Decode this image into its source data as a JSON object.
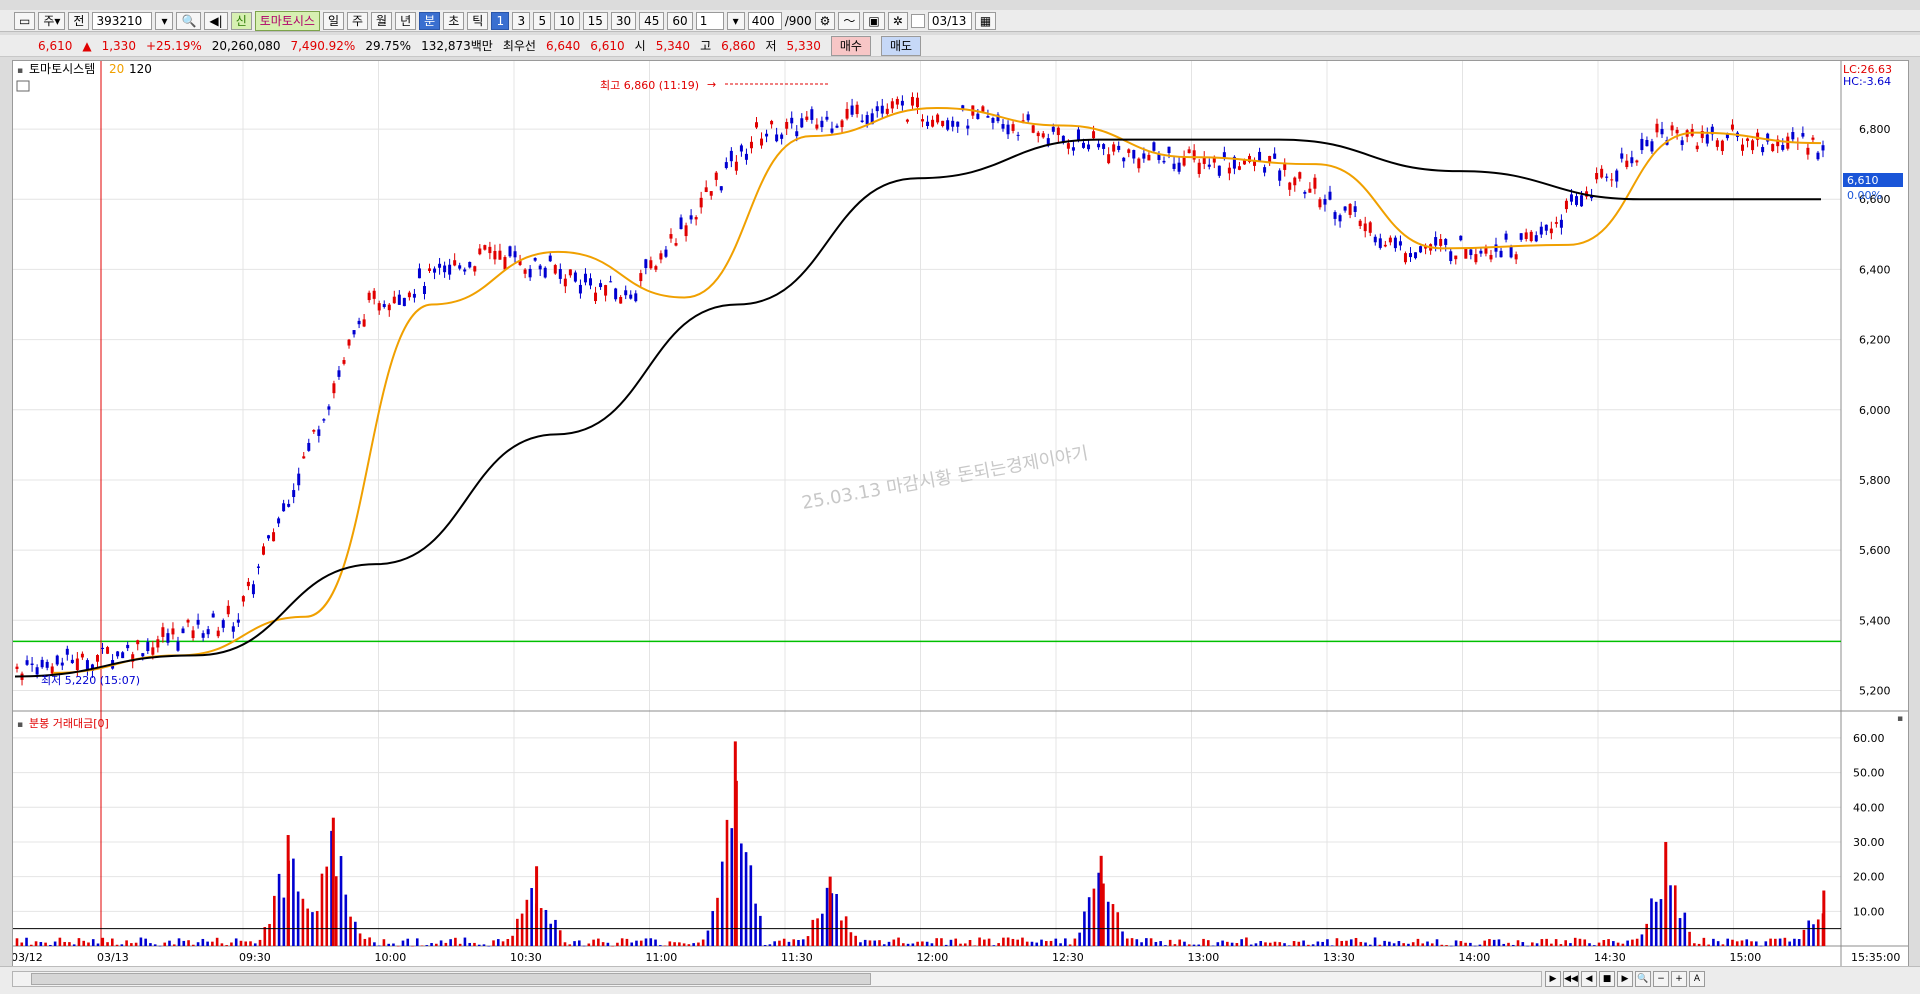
{
  "toolbar": {
    "market_code": "주",
    "period_type": "전",
    "stock_code": "393210",
    "new_badge": "신",
    "stock_name": "토마토시스",
    "period_buttons": [
      "일",
      "주",
      "월",
      "년",
      "분",
      "초",
      "틱"
    ],
    "minute_buttons": [
      "1",
      "3",
      "5",
      "10",
      "15",
      "30",
      "45",
      "60"
    ],
    "interval_value": "1",
    "count_value": "400",
    "count_total": "/900",
    "date_value": "03/13"
  },
  "quote": {
    "price": "6,610",
    "change": "1,330",
    "change_pct": "+25.19%",
    "volume": "20,260,080",
    "volume_ratio": "7,490.92%",
    "turnover": "29.75%",
    "trading_value": "132,873백만",
    "priority_label": "최우선",
    "ask": "6,640",
    "bid": "6,610",
    "open_label": "시",
    "open": "5,340",
    "high_label": "고",
    "high": "6,860",
    "low_label": "저",
    "low": "5,330",
    "buy_label": "매수",
    "sell_label": "매도"
  },
  "price_panel": {
    "legend_name": "토마토시스템",
    "ma20_label": "20",
    "ma120_label": "120",
    "lc_text": "LC:26.63",
    "hc_text": "HC:-3.64",
    "current_price_tag": "6,610",
    "current_pct_tag": "0.00%",
    "high_annotation": "최고 6,860 (11:19)",
    "low_annotation": "최저 5,220 (15:07)",
    "watermark": "25.03.13 마감시황 돈되는경제이야기",
    "colors": {
      "up": "#e00000",
      "down": "#0000d0",
      "ma20": "#f0a000",
      "ma120": "#000000",
      "support": "#00c000"
    }
  },
  "volume_panel": {
    "title": "분봉 거래대금[0]"
  },
  "chart_data": [
    {
      "type": "candlestick",
      "title": "토마토시스템",
      "y_ticks": [
        "6,800",
        "6,600",
        "6,400",
        "6,200",
        "6,000",
        "5,800",
        "5,600",
        "5,400",
        "5,200"
      ],
      "ylim": [
        5170,
        6880
      ],
      "x_ticks": [
        "03/12",
        "03/13",
        "09:30",
        "10:00",
        "10:30",
        "11:00",
        "11:30",
        "12:00",
        "12:30",
        "13:00",
        "13:30",
        "14:00",
        "14:30",
        "15:00",
        "15:35:00"
      ],
      "series": [
        {
          "name": "20",
          "values_approx": [
            5250,
            5300,
            5410,
            6300,
            6450,
            6320,
            6780,
            6860,
            6810,
            6720,
            6700,
            6460,
            6470,
            6790,
            6760
          ]
        },
        {
          "name": "120",
          "values_approx": [
            5240,
            5300,
            5560,
            5930,
            6300,
            6660,
            6770,
            6770,
            6680,
            6600,
            6600
          ]
        }
      ],
      "support_line": 5340,
      "last_price": 6610
    },
    {
      "type": "bar",
      "title": "분봉 거래대금[0]",
      "y_ticks": [
        "60.00",
        "50.00",
        "40.00",
        "30.00",
        "20.00",
        "10.00"
      ],
      "ylim": [
        0,
        62
      ],
      "peaks": [
        {
          "time": "09:40",
          "value": 32
        },
        {
          "time": "09:50",
          "value": 37
        },
        {
          "time": "10:35",
          "value": 23
        },
        {
          "time": "11:19",
          "value": 59
        },
        {
          "time": "11:40",
          "value": 20
        },
        {
          "time": "12:40",
          "value": 26
        },
        {
          "time": "14:45",
          "value": 30
        },
        {
          "time": "15:20",
          "value": 16
        }
      ]
    }
  ]
}
